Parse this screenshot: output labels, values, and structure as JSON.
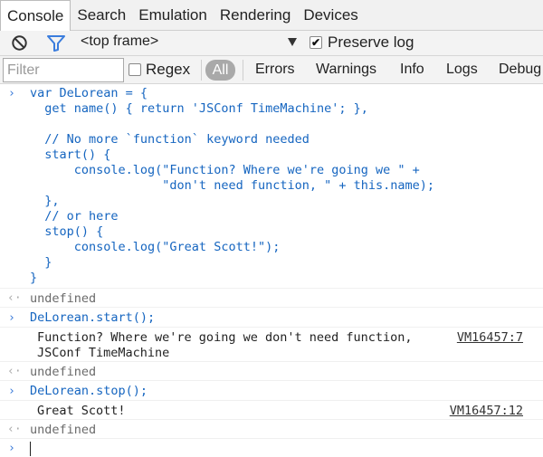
{
  "tabs": [
    "Console",
    "Search",
    "Emulation",
    "Rendering",
    "Devices"
  ],
  "toolbar": {
    "clear_icon": "no-entry-icon",
    "filter_icon": "funnel-icon",
    "frame_selector": "<top frame>",
    "preserve_log_label": "Preserve log",
    "preserve_log_checked": true,
    "check_mark": "✔"
  },
  "filterbar": {
    "placeholder": "Filter",
    "regex_label": "Regex",
    "levels": [
      "All",
      "Errors",
      "Warnings",
      "Info",
      "Logs",
      "Debug"
    ]
  },
  "console": {
    "input_1": "var DeLorean = {\n  get name() { return 'JSConf TimeMachine'; },\n\n  // No more `function` keyword needed\n  start() {\n      console.log(\"Function? Where we're going we \" +\n                  \"don't need function, \" + this.name);\n  },\n  // or here\n  stop() {\n      console.log(\"Great Scott!\");\n  }\n}",
    "result_1": "undefined",
    "input_2": "DeLorean.start();",
    "output_2a": "Function? Where we're going we don't need function,",
    "output_2b": "JSConf TimeMachine",
    "source_2": "VM16457:7",
    "result_2": "undefined",
    "input_3": "DeLorean.stop();",
    "output_3": "Great Scott!",
    "source_3": "VM16457:12",
    "result_3": "undefined",
    "prompt_glyph": "›",
    "result_glyph": "‹·"
  }
}
